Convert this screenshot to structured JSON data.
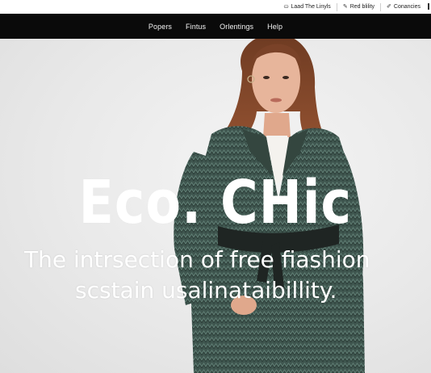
{
  "utility": {
    "items": [
      {
        "label": "Laad The Linyls",
        "icon": "bag-icon"
      },
      {
        "label": "Red blility",
        "icon": "pencil-icon"
      },
      {
        "label": "Conancies",
        "icon": "edit-icon"
      }
    ]
  },
  "nav": {
    "items": [
      "Popers",
      "Fintus",
      "Orlentings",
      "Help"
    ]
  },
  "hero": {
    "title": "Eco. CHic",
    "subtitle_line1": "The intrsection of free fiashion",
    "subtitle_line2": "scstain usalinataibillity.",
    "colors": {
      "background": "#e9e9e9",
      "coat": "#3f564f",
      "coat_dark": "#2a3a35",
      "hair": "#8a4a2c",
      "skin": "#e7b59b",
      "belt": "#1f2523",
      "text": "#ffffff"
    }
  }
}
